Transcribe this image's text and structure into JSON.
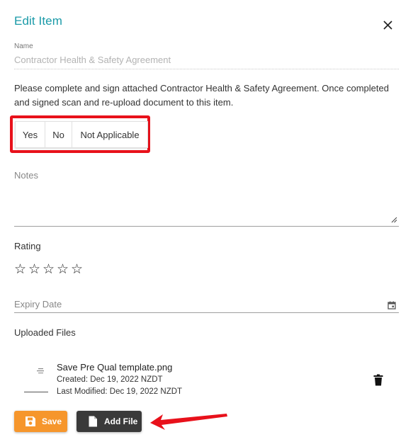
{
  "dialog": {
    "title": "Edit Item",
    "close_icon": "close-icon"
  },
  "name_field": {
    "label": "Name",
    "value": "Contractor Health & Safety Agreement"
  },
  "description": "Please complete and sign attached Contractor Health & Safety Agreement. Once completed and signed scan and re-upload document to this item.",
  "options": [
    {
      "label": "Yes"
    },
    {
      "label": "No"
    },
    {
      "label": "Not Applicable"
    }
  ],
  "notes": {
    "placeholder": "Notes",
    "value": ""
  },
  "rating": {
    "label": "Rating",
    "value": 0,
    "max": 5,
    "empty_star": "☆"
  },
  "expiry": {
    "placeholder": "Expiry Date",
    "icon": "calendar-icon"
  },
  "uploaded_files": {
    "label": "Uploaded Files",
    "files": [
      {
        "name": "Save Pre Qual template.png",
        "created": "Created: Dec 19, 2022 NZDT",
        "modified": "Last Modified: Dec 19, 2022 NZDT"
      }
    ]
  },
  "actions": {
    "save_label": "Save",
    "add_file_label": "Add File"
  },
  "colors": {
    "accent": "#1a9aa8",
    "save": "#f6962c",
    "add_file": "#3a3a3a",
    "annotation": "#e8111b"
  }
}
